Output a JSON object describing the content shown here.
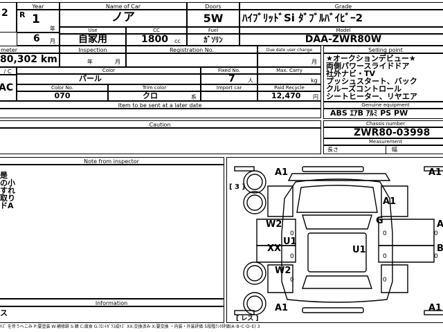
{
  "sheet": {
    "year_hdr": "Year",
    "era": "R",
    "year_num": "1",
    "year_unit": "年",
    "month_num": "6",
    "month_unit": "月",
    "left_num": "2",
    "name_hdr": "Name of Car",
    "car_name": "ノア",
    "doors_hdr": "Doors",
    "doors": "5W",
    "grade_hdr": "Grade",
    "grade": "ﾊｲﾌﾞﾘｯﾄﾞSi ﾀﾞﾌﾞﾙﾊﾞｲﾋﾞｰ2",
    "use_hdr": "Use",
    "use": "自家用",
    "cc_hdr": "CC",
    "cc": "1800",
    "cc_unit": "cc",
    "fuel_hdr": "Fuel",
    "fuel": "ｶﾞｿﾘﾝ",
    "model_hdr": "Model",
    "model": "DAA-ZWR80W",
    "meter_hdr": "meter",
    "mileage": "80,302 km",
    "inspection_hdr": "Inspection",
    "insp_year": "年",
    "insp_month": "月",
    "reg_hdr": "Registration No.",
    "due_hdr": "Due date user change",
    "due_month": "月",
    "selling_hdr": "Selling point",
    "selling": [
      "★オークションデビュー★",
      "両側パワースライドドア",
      "社外ナビ・TV",
      "プッシュスタート、バック",
      "クルーズコントロール",
      "シートヒーター、リヤエア"
    ],
    "c_hdr": "/ C",
    "ac": "AC",
    "color_hdr": "Color",
    "color": "パール",
    "fixed_hdr": "Fixed No.",
    "fixed": "7",
    "fixed_unit": "人",
    "carry_hdr": "Max. Carry",
    "carry_unit": "kg",
    "colorno_hdr": "Color No.",
    "colorno": "070",
    "trim_hdr": "Trim color",
    "trim": "クロ",
    "trim_unit": "系",
    "import_hdr": "Import car",
    "recycle_hdr": "Paid Recycle",
    "recycle": "12,470",
    "recycle_unit": "円",
    "later_hdr": "Item to be sent at a later date",
    "genuine_hdr": "Genuine equipment",
    "genuine": "ABS ｴｱB ｱﾙﾐ PS PW",
    "caution_hdr": "Caution",
    "chassis_hdr": "Chassis number",
    "chassis": "ZWR80-03998",
    "measure_hdr": "Measurement",
    "length": "長さ",
    "width": "幅",
    "note_hdr": "Note from inspector",
    "notes": [
      "是",
      "の小",
      "すれ",
      "取り",
      "ドA"
    ],
    "info_hdr": "Information",
    "info": "ス",
    "footer": "ｷｽﾞ を伴うへこみ P:要塗装 W:補修跡 S:錆 C:腐食 G:ﾌﾛﾝﾄｶﾞﾗｽ成ｷｽﾞ XX:交換済み X:要交換 ・内装・外装評価 5段階ﾗﾝｸ評価(A･B･C･D･E) 3"
  },
  "diagram": {
    "bracket_top": "[ 3 ]",
    "bracket_left": "[ 3",
    "bracket_bottom": "[ レス ]",
    "marks": [
      {
        "id": "a1-top-left",
        "label": "A1"
      },
      {
        "id": "a1-top-right",
        "label": "A1"
      },
      {
        "id": "a1-hood",
        "label": "A1"
      },
      {
        "id": "g-glass",
        "label": "G"
      },
      {
        "id": "w2-front-door",
        "label": "W2"
      },
      {
        "id": "u1-left",
        "label": "U1"
      },
      {
        "id": "xx-left",
        "label": "XX"
      },
      {
        "id": "u1-roof",
        "label": "U1"
      },
      {
        "id": "w2-rear",
        "label": "W2"
      },
      {
        "id": "a-right",
        "label": "A"
      },
      {
        "id": "b-right",
        "label": "B"
      },
      {
        "id": "a1-bottom-left",
        "label": "A1"
      },
      {
        "id": "a1-bottom-right",
        "label": "A1"
      }
    ],
    "zeros": [
      "0",
      "0",
      "0",
      "0",
      "0",
      "0",
      "0",
      "0"
    ]
  }
}
